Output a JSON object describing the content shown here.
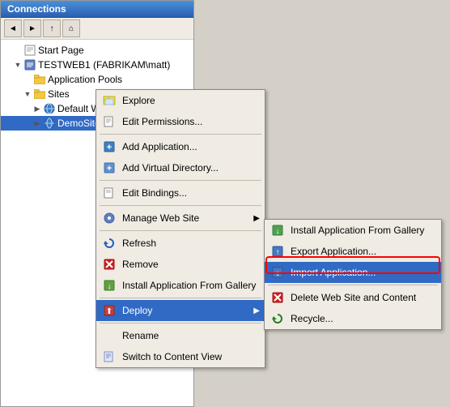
{
  "panel": {
    "title": "Connections",
    "toolbar": {
      "back_label": "◄",
      "forward_label": "►",
      "up_label": "↑",
      "home_label": "⌂"
    }
  },
  "tree": {
    "items": [
      {
        "label": "Start Page",
        "indent": "indent1",
        "expand": "",
        "icon": "page"
      },
      {
        "label": "TESTWEB1 (FABRIKAM\\matt)",
        "indent": "indent1",
        "expand": "▼",
        "icon": "server"
      },
      {
        "label": "Application Pools",
        "indent": "indent2",
        "expand": "",
        "icon": "folder"
      },
      {
        "label": "Sites",
        "indent": "indent2",
        "expand": "▼",
        "icon": "folder"
      },
      {
        "label": "Default Web Site",
        "indent": "indent3",
        "expand": "▶",
        "icon": "globe"
      },
      {
        "label": "DemoSite",
        "indent": "indent3",
        "expand": "▶",
        "icon": "globe",
        "selected": true
      }
    ]
  },
  "context_menu": {
    "items": [
      {
        "id": "explore",
        "label": "Explore",
        "icon": "explore",
        "has_arrow": false
      },
      {
        "id": "edit-permissions",
        "label": "Edit Permissions...",
        "icon": "page",
        "has_arrow": false
      },
      {
        "id": "sep1",
        "type": "separator"
      },
      {
        "id": "add-application",
        "label": "Add Application...",
        "icon": "blue-box",
        "has_arrow": false
      },
      {
        "id": "add-virtual-dir",
        "label": "Add Virtual Directory...",
        "icon": "blue-box",
        "has_arrow": false
      },
      {
        "id": "sep2",
        "type": "separator"
      },
      {
        "id": "edit-bindings",
        "label": "Edit Bindings...",
        "icon": "page",
        "has_arrow": false
      },
      {
        "id": "sep3",
        "type": "separator"
      },
      {
        "id": "manage-web-site",
        "label": "Manage Web Site",
        "icon": "gear",
        "has_arrow": true
      },
      {
        "id": "sep4",
        "type": "separator"
      },
      {
        "id": "refresh",
        "label": "Refresh",
        "icon": "refresh",
        "has_arrow": false
      },
      {
        "id": "remove",
        "label": "Remove",
        "icon": "red-x",
        "has_arrow": false
      },
      {
        "id": "install-gallery",
        "label": "Install Application From Gallery",
        "icon": "install",
        "has_arrow": false
      },
      {
        "id": "sep5",
        "type": "separator"
      },
      {
        "id": "deploy",
        "label": "Deploy",
        "icon": "deploy",
        "has_arrow": true,
        "highlighted": true
      },
      {
        "id": "sep6",
        "type": "separator"
      },
      {
        "id": "rename",
        "label": "Rename",
        "icon": "none",
        "has_arrow": false
      },
      {
        "id": "switch-content",
        "label": "Switch to Content View",
        "icon": "page",
        "has_arrow": false
      }
    ]
  },
  "submenu": {
    "items": [
      {
        "id": "install-gallery-sub",
        "label": "Install Application From Gallery",
        "icon": "green",
        "has_arrow": false
      },
      {
        "id": "export-app",
        "label": "Export Application...",
        "icon": "blue",
        "has_arrow": false
      },
      {
        "id": "import-app",
        "label": "Import Application...",
        "icon": "blue",
        "has_arrow": false,
        "highlighted": true
      },
      {
        "id": "sep1",
        "type": "separator"
      },
      {
        "id": "delete-web",
        "label": "Delete Web Site and Content",
        "icon": "red-x",
        "has_arrow": false
      },
      {
        "id": "recycle",
        "label": "Recycle...",
        "icon": "refresh",
        "has_arrow": false
      }
    ]
  },
  "highlight": {
    "label": "Import Application...",
    "circle_note": "red circle around Import Application"
  }
}
